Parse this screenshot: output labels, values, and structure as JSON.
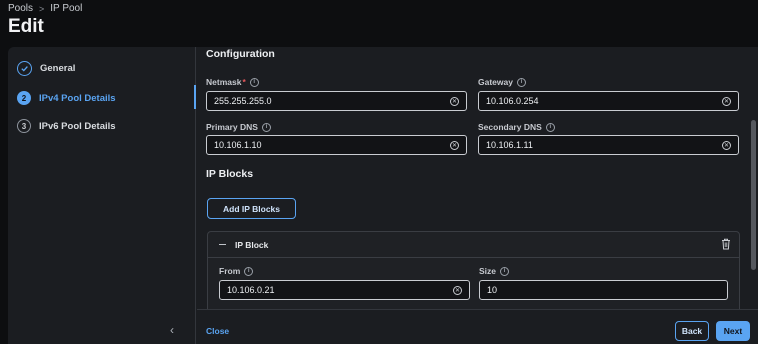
{
  "breadcrumb": {
    "items": [
      "Pools",
      "IP Pool"
    ],
    "separator": ">"
  },
  "page": {
    "title": "Edit"
  },
  "steps": [
    {
      "number": "",
      "label": "General",
      "state": "done"
    },
    {
      "number": "2",
      "label": "IPv4 Pool Details",
      "state": "active"
    },
    {
      "number": "3",
      "label": "IPv6 Pool Details",
      "state": "pending"
    }
  ],
  "configuration": {
    "title": "Configuration",
    "netmask": {
      "label": "Netmask",
      "required_mark": "*",
      "value": "255.255.255.0"
    },
    "gateway": {
      "label": "Gateway",
      "value": "10.106.0.254"
    },
    "primary_dns": {
      "label": "Primary DNS",
      "value": "10.106.1.10"
    },
    "secondary_dns": {
      "label": "Secondary DNS",
      "value": "10.106.1.11"
    }
  },
  "ip_blocks": {
    "title": "IP Blocks",
    "add_button": "Add IP Blocks",
    "block": {
      "title": "IP Block",
      "from": {
        "label": "From",
        "value": "10.106.0.21"
      },
      "size": {
        "label": "Size",
        "value": "10"
      }
    }
  },
  "footer": {
    "close": "Close",
    "back": "Back",
    "next": "Next"
  },
  "colors": {
    "accent": "#5aa4f2",
    "background": "#0d0e10",
    "panel": "#1b1d21",
    "required": "#e4575b"
  },
  "icons": {
    "info": "info-icon",
    "clear": "clear-icon",
    "delete": "trash-icon",
    "done_step": "check-icon",
    "collapse": "chevron-left-icon"
  }
}
